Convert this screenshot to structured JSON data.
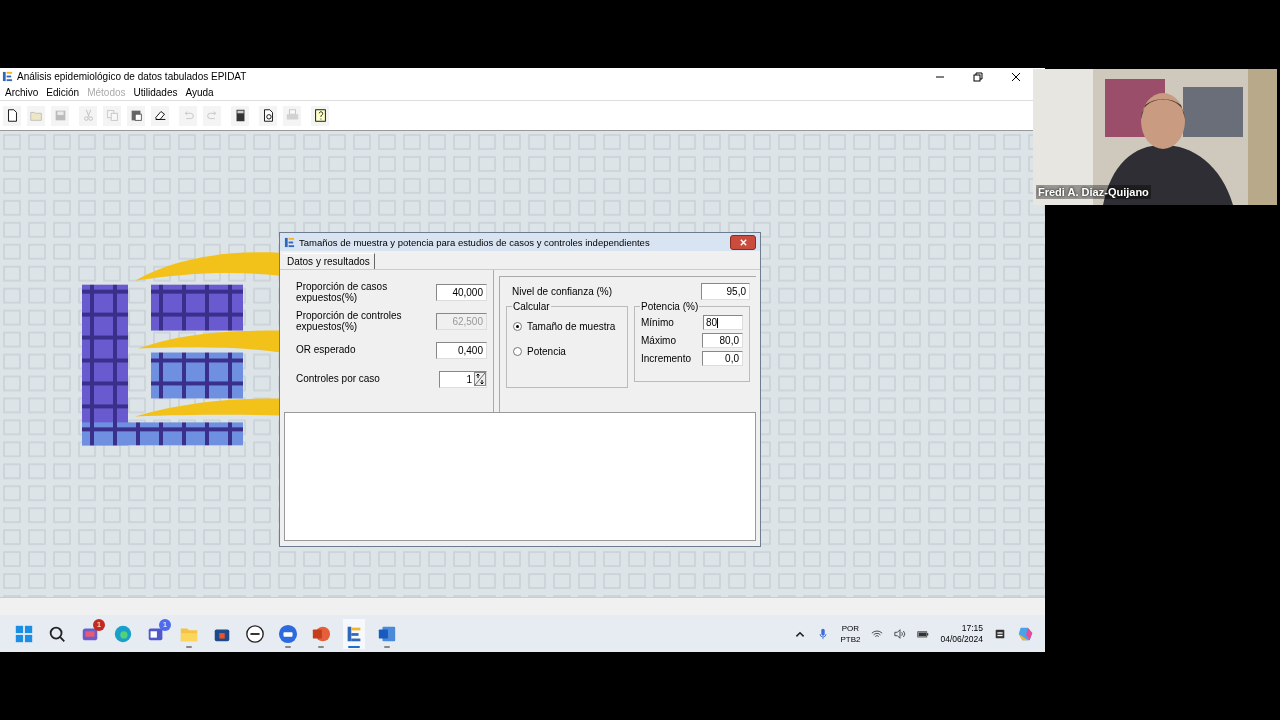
{
  "window": {
    "title": "Análisis epidemiológico de datos tabulados EPIDAT"
  },
  "menu": [
    {
      "label": "Archivo",
      "disabled": false
    },
    {
      "label": "Edición",
      "disabled": false
    },
    {
      "label": "Métodos",
      "disabled": true
    },
    {
      "label": "Utilidades",
      "disabled": false
    },
    {
      "label": "Ayuda",
      "disabled": false
    }
  ],
  "toolbar": [
    [
      {
        "disabled": false
      },
      {
        "disabled": true
      },
      {
        "disabled": true
      }
    ],
    [
      {
        "disabled": true
      },
      {
        "disabled": true
      },
      {
        "disabled": false
      },
      {
        "disabled": false
      }
    ],
    [
      {
        "disabled": true
      },
      {
        "disabled": true
      }
    ],
    [
      {
        "disabled": false
      }
    ],
    [
      {
        "disabled": false
      },
      {
        "disabled": true
      }
    ],
    [
      {
        "disabled": false
      }
    ]
  ],
  "dialog": {
    "title": "Tamaños de muestra y potencia para estudios de casos y controles independientes",
    "tabs": [
      {
        "label": "Datos y resultados",
        "selected": true
      }
    ],
    "inputs": [
      {
        "label": "Proporción de casos expuestos(%)",
        "value": "40,000",
        "disabled": false
      },
      {
        "label": "Proporción de controles expuestos(%)",
        "value": "62,500",
        "disabled": true
      },
      {
        "label": "OR esperado",
        "value": "0,400",
        "disabled": false
      }
    ],
    "spinner": {
      "label": "Controles por caso",
      "value": "1"
    },
    "confidence": {
      "label": "Nivel de confianza (%)",
      "value": "95,0"
    },
    "calculate": {
      "title": "Calcular",
      "options": [
        {
          "label": "Tamaño de muestra",
          "selected": true
        },
        {
          "label": "Potencia",
          "selected": false
        }
      ]
    },
    "power": {
      "title": "Potencia (%)",
      "fields": [
        {
          "label": "Mínimo",
          "value": "80",
          "editing": true
        },
        {
          "label": "Máximo",
          "value": "80,0",
          "editing": false
        },
        {
          "label": "Incremento",
          "value": "0,0",
          "editing": false
        }
      ]
    }
  },
  "taskbar": {
    "apps": [
      {
        "running": false,
        "active": false
      },
      {
        "running": false,
        "active": false
      },
      {
        "badge": "1",
        "running": false,
        "active": false
      },
      {
        "running": false,
        "active": false
      },
      {
        "badge": "1",
        "running": false,
        "active": false
      },
      {
        "running": true,
        "active": false
      },
      {
        "running": false,
        "active": false
      },
      {
        "running": false,
        "active": false
      },
      {
        "running": true,
        "active": false
      },
      {
        "running": true,
        "active": false
      },
      {
        "running": true,
        "active": true
      },
      {
        "running": true,
        "active": false
      }
    ],
    "language": [
      "POR",
      "PTB2"
    ],
    "time": "17:15",
    "date": "04/06/2024"
  },
  "video": {
    "name": "Fredi A. Diaz-Quijano"
  }
}
